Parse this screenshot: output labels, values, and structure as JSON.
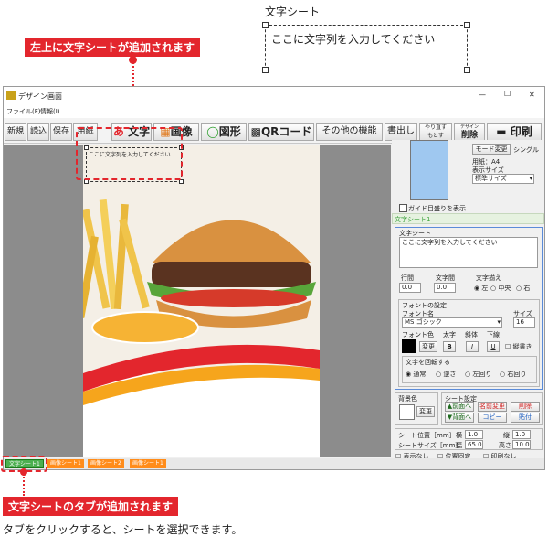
{
  "preview": {
    "label": "文字シート",
    "text": "ここに文字列を入力してください"
  },
  "callout_top": "左上に文字シートが追加されます",
  "callout_bottom": "文字シートのタブが追加されます",
  "caption": "タブをクリックすると、シートを選択できます。",
  "window": {
    "title": "デザイン画面",
    "min": "—",
    "max": "☐",
    "close": "✕"
  },
  "menu": [
    "ファイル(F)",
    "情報(I)"
  ],
  "toolbar": {
    "new": "新規",
    "load": "読込",
    "save": "保存",
    "paper": "用紙",
    "text": "文字",
    "image": "画像",
    "shape": "図形",
    "qr": "QRコード",
    "other": "その他の機能",
    "export": "書出し",
    "redo": "やり直す",
    "undo": "もとす",
    "delete_top": "デザイン",
    "delete": "削除",
    "print": "印刷"
  },
  "canvas": {
    "sheet_text": "ここに文字列を入力してください"
  },
  "panel": {
    "mode_btn": "モード変更",
    "single": "シングル",
    "paper": "用紙：A4",
    "display_size_label": "表示サイズ",
    "display_size": "標準サイズ",
    "guide": "ガイド目盛りを表示",
    "sheet_title": "文字シート1",
    "text_group": "文字シート",
    "text_value": "ここに文字列を入力してください",
    "line_spacing": "行間",
    "line_value": "0.0",
    "char_spacing": "文字間",
    "char_value": "0.0",
    "align_label": "文字揃え",
    "align": [
      "左",
      "中央",
      "右"
    ],
    "font_group": "フォントの設定",
    "font_name_label": "フォント名",
    "font_name": "MS ゴシック",
    "size_label": "サイズ",
    "size": "16",
    "font_color": "フォント色",
    "bold_label": "太字",
    "italic_label": "斜体",
    "underline_label": "下線",
    "change": "変更",
    "bold": "B",
    "italic": "I",
    "underline": "U",
    "vertical": "縦書き",
    "rotate_group": "文字を回転する",
    "rotate": [
      "通常",
      "逆さ",
      "左回り",
      "右回り"
    ],
    "bg_label": "背景色",
    "bg_change": "変更",
    "sheet_settings": "シート設定",
    "front": "▲前面へ",
    "back": "▼背面へ",
    "rename": "名前変更",
    "copy": "コピー",
    "del": "削除",
    "paste": "貼付",
    "pos_label": "シート位置［mm］",
    "x_label": "横",
    "x": "1.0",
    "y_label": "縦",
    "y": "1.0",
    "size_label2": "シートサイズ［mm］",
    "w_label": "幅",
    "w": "65.0",
    "h_label": "高さ",
    "h": "10.0",
    "hide": "表示なし",
    "lock": "位置固定",
    "noprint": "印刷なし"
  },
  "tabs": [
    "文字シート1",
    "画像シート1",
    "画像シート2",
    "画像シート1"
  ],
  "colors": {
    "accent": "#e3262d",
    "tab": "#ff8c1a",
    "tab_active": "#4caf50",
    "sheet_title": "#3fa33f"
  }
}
